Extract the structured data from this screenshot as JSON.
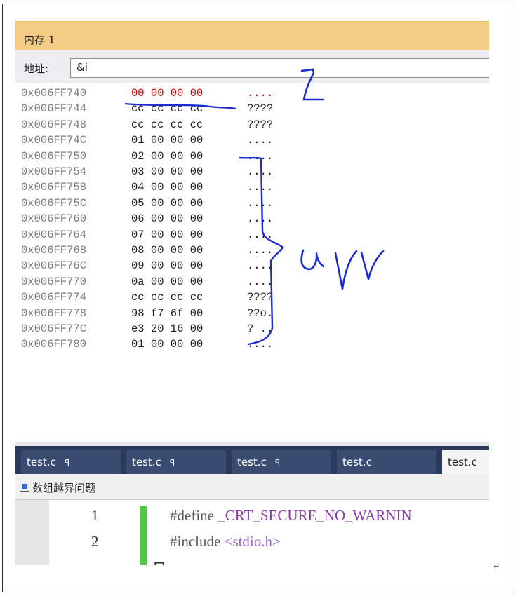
{
  "window": {
    "title": "内存 1",
    "address_label": "地址:",
    "address_value": "&i"
  },
  "memory_rows": [
    {
      "address": "0x006FF740",
      "bytes": "00 00 00 00",
      "ascii": "....",
      "highlight": true
    },
    {
      "address": "0x006FF744",
      "bytes": "cc cc cc cc",
      "ascii": "????",
      "highlight": false
    },
    {
      "address": "0x006FF748",
      "bytes": "cc cc cc cc",
      "ascii": "????",
      "highlight": false
    },
    {
      "address": "0x006FF74C",
      "bytes": "01 00 00 00",
      "ascii": "....",
      "highlight": false
    },
    {
      "address": "0x006FF750",
      "bytes": "02 00 00 00",
      "ascii": "....",
      "highlight": false
    },
    {
      "address": "0x006FF754",
      "bytes": "03 00 00 00",
      "ascii": "....",
      "highlight": false
    },
    {
      "address": "0x006FF758",
      "bytes": "04 00 00 00",
      "ascii": "....",
      "highlight": false
    },
    {
      "address": "0x006FF75C",
      "bytes": "05 00 00 00",
      "ascii": "....",
      "highlight": false
    },
    {
      "address": "0x006FF760",
      "bytes": "06 00 00 00",
      "ascii": "....",
      "highlight": false
    },
    {
      "address": "0x006FF764",
      "bytes": "07 00 00 00",
      "ascii": "....",
      "highlight": false
    },
    {
      "address": "0x006FF768",
      "bytes": "08 00 00 00",
      "ascii": "....",
      "highlight": false
    },
    {
      "address": "0x006FF76C",
      "bytes": "09 00 00 00",
      "ascii": "....",
      "highlight": false
    },
    {
      "address": "0x006FF770",
      "bytes": "0a 00 00 00",
      "ascii": "....",
      "highlight": false
    },
    {
      "address": "0x006FF774",
      "bytes": "cc cc cc cc",
      "ascii": "????",
      "highlight": false
    },
    {
      "address": "0x006FF778",
      "bytes": "98 f7 6f 00",
      "ascii": "??o.",
      "highlight": false
    },
    {
      "address": "0x006FF77C",
      "bytes": "e3 20 16 00",
      "ascii": "? ..",
      "highlight": false
    },
    {
      "address": "0x006FF780",
      "bytes": "01 00 00 00",
      "ascii": "....",
      "highlight": false
    }
  ],
  "tabs": [
    {
      "label": "test.c",
      "pin": "ꟼ",
      "active": false
    },
    {
      "label": "test.c",
      "pin": "ꟼ",
      "active": false
    },
    {
      "label": "test.c",
      "pin": "ꟼ",
      "active": false
    },
    {
      "label": "test.c",
      "pin": "",
      "active": false
    },
    {
      "label": "test.c",
      "pin": "",
      "active": true
    }
  ],
  "bookmark": {
    "label": "数组越界问题"
  },
  "editor": {
    "lines": [
      {
        "number": "1",
        "directive": "#define ",
        "rest": "_CRT_SECURE_NO_WARNIN"
      },
      {
        "number": "2",
        "directive": "#include ",
        "rest": "<stdio.h>"
      }
    ]
  },
  "annotations": {
    "handwritten_i": "i",
    "handwritten_arr": "arr"
  },
  "colors": {
    "title_bar": "#f5cc84",
    "tab_bar": "#2b3a5a",
    "highlight_text": "#e00000",
    "ink": "#1a2ad4",
    "gutter_green": "#57c24c"
  }
}
